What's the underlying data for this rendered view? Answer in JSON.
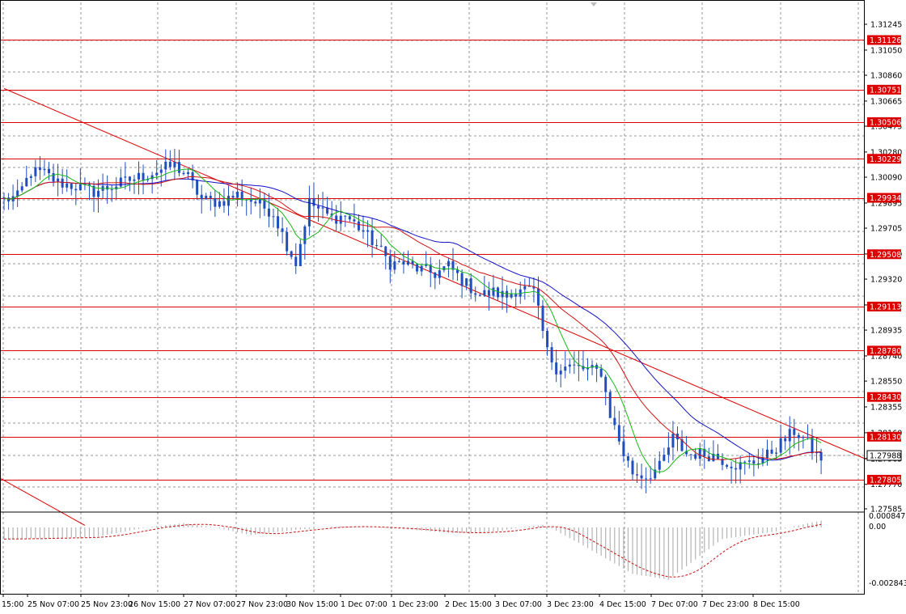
{
  "chart_data": {
    "type": "line",
    "subtype": "candlestick-with-moving-averages",
    "instrument_note": "",
    "background": "#ffffff",
    "colors": {
      "candle": "#1f4fbf",
      "ma_slow": "#1111c8",
      "ma_mid": "#d01414",
      "ma_fast": "#18b818",
      "level": "#dd0000",
      "trendline": "#dd0000",
      "grid": "#9a9a9a",
      "osc_hist": "#b4b4b4",
      "osc_signal": "#c81414",
      "price_tag_bg": "#dd0000",
      "price_tag_text": "#ffffff",
      "current_tag_bg": "#ffffff",
      "current_tag_text": "#000000"
    },
    "grid": true,
    "ylim": [
      1.2755,
      1.3141
    ],
    "price_axis_ticks": [
      "1.31245",
      "1.31050",
      "1.30860",
      "1.30665",
      "1.30475",
      "1.30280",
      "1.30090",
      "1.29895",
      "1.29705",
      "1.29510",
      "1.29320",
      "1.29125",
      "1.28935",
      "1.28740",
      "1.28550",
      "1.28355",
      "1.28160",
      "1.27965",
      "1.27770",
      "1.27585"
    ],
    "horizontal_levels": [
      "1.31126",
      "1.30751",
      "1.30506",
      "1.30229",
      "1.29934",
      "1.29508",
      "1.29113",
      "1.28780",
      "1.28430",
      "1.28130",
      "1.27805"
    ],
    "current_price": "1.27988",
    "time_labels": [
      "15:00",
      "25 Nov 07:00",
      "25 Nov 23:00",
      "26 Nov 15:00",
      "27 Nov 07:00",
      "27 Nov 23:00",
      "30 Nov 15:00",
      "1 Dec 07:00",
      "1 Dec 23:00",
      "2 Dec 15:00",
      "3 Dec 07:00",
      "3 Dec 23:00",
      "4 Dec 15:00",
      "7 Dec 07:00",
      "7 Dec 23:00",
      "8 Dec 15:00"
    ],
    "trendlines": [
      {
        "from": [
          0,
          1.3076
        ],
        "to": [
          192,
          1.2796
        ]
      },
      {
        "from": [
          -9,
          1.2797
        ],
        "to": [
          18,
          1.2746
        ]
      }
    ],
    "close_anchors": [
      [
        0,
        1.2992
      ],
      [
        3,
        1.2994
      ],
      [
        6,
        1.3013
      ],
      [
        9,
        1.3012
      ],
      [
        12,
        1.3005
      ],
      [
        16,
        1.3002
      ],
      [
        20,
        1.2998
      ],
      [
        24,
        1.3002
      ],
      [
        28,
        1.3007
      ],
      [
        32,
        1.3011
      ],
      [
        36,
        1.3016
      ],
      [
        38,
        1.3018
      ],
      [
        41,
        1.3009
      ],
      [
        44,
        1.2992
      ],
      [
        48,
        1.299
      ],
      [
        52,
        1.2996
      ],
      [
        56,
        1.299
      ],
      [
        60,
        1.2982
      ],
      [
        63,
        1.2958
      ],
      [
        65,
        1.2944
      ],
      [
        68,
        1.299
      ],
      [
        70,
        1.2985
      ],
      [
        73,
        1.2978
      ],
      [
        76,
        1.298
      ],
      [
        80,
        1.2968
      ],
      [
        83,
        1.2957
      ],
      [
        86,
        1.2944
      ],
      [
        89,
        1.2944
      ],
      [
        92,
        1.294
      ],
      [
        96,
        1.2936
      ],
      [
        99,
        1.2942
      ],
      [
        102,
        1.2931
      ],
      [
        106,
        1.292
      ],
      [
        109,
        1.2922
      ],
      [
        112,
        1.2919
      ],
      [
        115,
        1.2926
      ],
      [
        118,
        1.2922
      ],
      [
        121,
        1.2877
      ],
      [
        123,
        1.2865
      ],
      [
        126,
        1.2866
      ],
      [
        129,
        1.2864
      ],
      [
        133,
        1.2862
      ],
      [
        135,
        1.283
      ],
      [
        138,
        1.28
      ],
      [
        140,
        1.2786
      ],
      [
        143,
        1.2783
      ],
      [
        146,
        1.279
      ],
      [
        149,
        1.2812
      ],
      [
        152,
        1.28
      ],
      [
        155,
        1.28
      ],
      [
        158,
        1.2799
      ],
      [
        161,
        1.2794
      ],
      [
        164,
        1.2791
      ],
      [
        167,
        1.2794
      ],
      [
        170,
        1.2799
      ],
      [
        173,
        1.2808
      ],
      [
        176,
        1.2817
      ],
      [
        178,
        1.2812
      ],
      [
        180,
        1.2803
      ],
      [
        182,
        1.2795
      ]
    ],
    "ma_periods": {
      "fast": 8,
      "mid": 21,
      "slow": 34
    },
    "oscillator": {
      "ticks": [
        "0.000847",
        "0.00",
        "-0.002843"
      ],
      "range": [
        -0.002843,
        0.000847
      ],
      "anchors": [
        [
          0,
          -0.0006
        ],
        [
          20,
          -0.0005
        ],
        [
          40,
          0.00035
        ],
        [
          55,
          -0.0004
        ],
        [
          62,
          -0.0002
        ],
        [
          75,
          0.0001
        ],
        [
          90,
          -0.0001
        ],
        [
          100,
          -0.0003
        ],
        [
          110,
          -0.0002
        ],
        [
          120,
          0.0002
        ],
        [
          128,
          -0.0008
        ],
        [
          140,
          -0.0024
        ],
        [
          148,
          -0.0027
        ],
        [
          160,
          -0.0006
        ],
        [
          172,
          -0.0002
        ],
        [
          182,
          0.00055
        ]
      ]
    }
  }
}
